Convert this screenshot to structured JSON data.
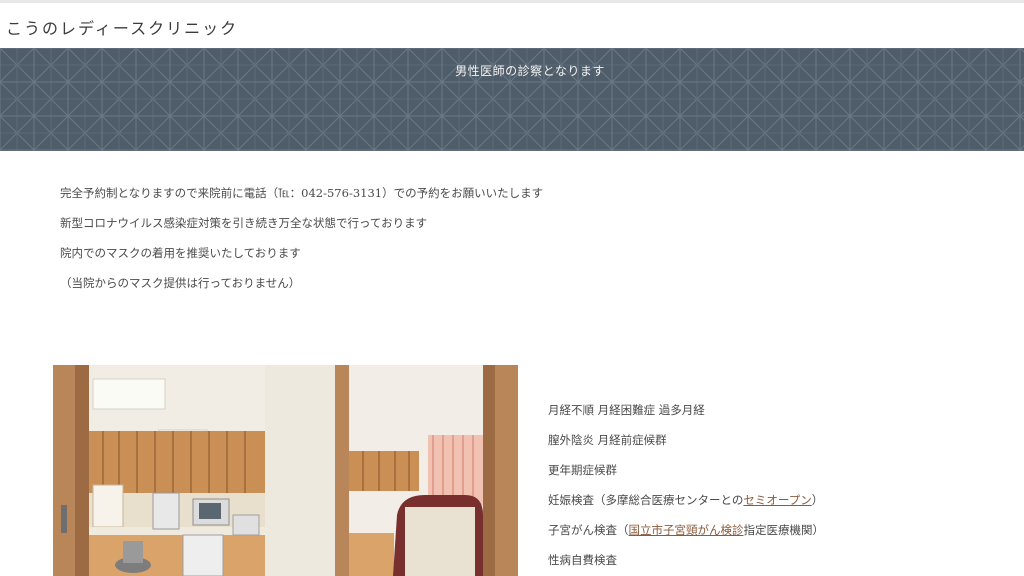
{
  "header": {
    "site_title": "こうのレディースクリニック"
  },
  "banner": {
    "text": "男性医師の診察となります"
  },
  "notices": [
    "完全予約制となりますので来院前に電話（℡：042-576-3131）での予約をお願いいたします",
    "新型コロナウイルス感染症対策を引き続き万全な状態で行っております",
    "院内でのマスクの着用を推奨いたしております",
    "（当院からのマスク提供は行っておりません）"
  ],
  "treatments": {
    "item1": "月経不順 月経困難症 過多月経",
    "item2": " 膣外陰炎 月経前症候群",
    "item3": "更年期症候群",
    "item4_prefix": "妊娠検査（多摩総合医療センターとの",
    "item4_link": "セミオープン",
    "item4_suffix": "）",
    "item5_prefix": "子宮がん検査（",
    "item5_link": "国立市子宮頸がん検診",
    "item5_suffix": "指定医療機関）",
    "item6": "性病自費検査"
  },
  "photo": {
    "icon": "clinic-interior-photo"
  },
  "colors": {
    "banner_bg": "#4f5d6a",
    "link": "#8a5a3c",
    "text": "#4a4a4a"
  }
}
